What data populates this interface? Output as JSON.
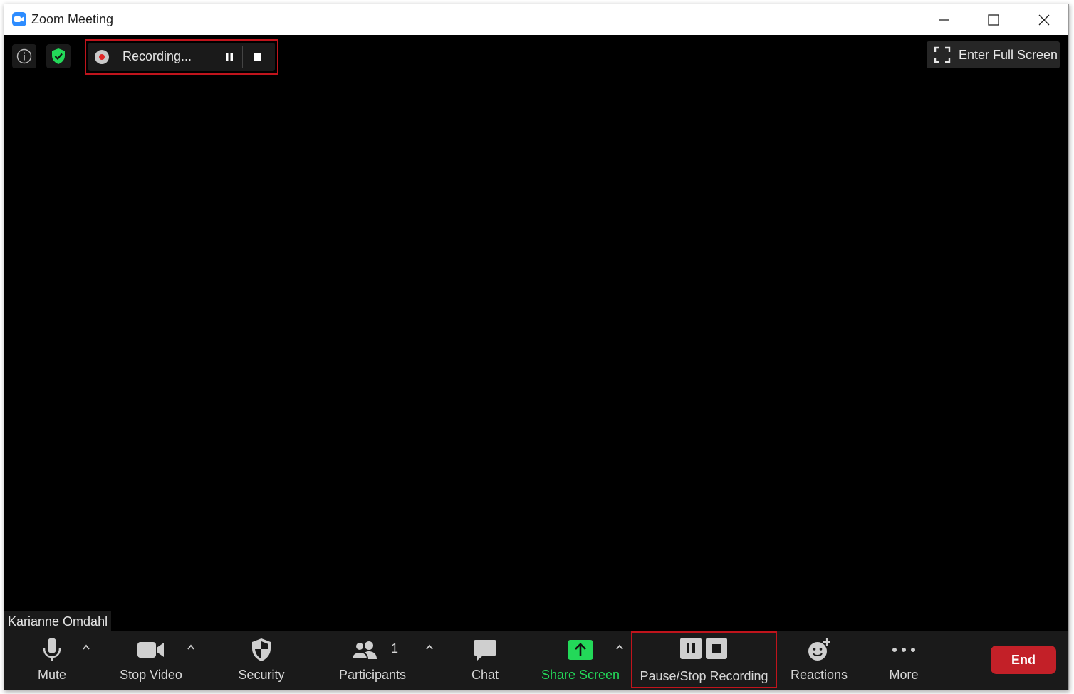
{
  "window": {
    "title": "Zoom Meeting"
  },
  "top_bar": {
    "recording": {
      "status_text": "Recording..."
    },
    "fullscreen_label": "Enter Full Screen"
  },
  "participant": {
    "name": "Karianne Omdahl"
  },
  "toolbar": {
    "mute_label": "Mute",
    "video_label": "Stop Video",
    "security_label": "Security",
    "participants_label": "Participants",
    "participants_count": "1",
    "chat_label": "Chat",
    "share_label": "Share Screen",
    "recording_label": "Pause/Stop Recording",
    "reactions_label": "Reactions",
    "more_label": "More",
    "end_label": "End"
  },
  "colors": {
    "share_green": "#23d959",
    "end_red": "#c32028",
    "highlight_red": "#c0141c",
    "security_shield_green": "#23d959"
  }
}
